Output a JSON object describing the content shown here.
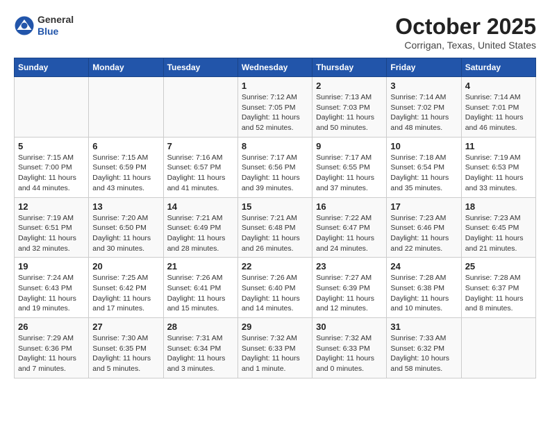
{
  "header": {
    "logo": {
      "general": "General",
      "blue": "Blue"
    },
    "title": "October 2025",
    "subtitle": "Corrigan, Texas, United States"
  },
  "weekdays": [
    "Sunday",
    "Monday",
    "Tuesday",
    "Wednesday",
    "Thursday",
    "Friday",
    "Saturday"
  ],
  "weeks": [
    [
      {
        "day": "",
        "info": ""
      },
      {
        "day": "",
        "info": ""
      },
      {
        "day": "",
        "info": ""
      },
      {
        "day": "1",
        "info": "Sunrise: 7:12 AM\nSunset: 7:05 PM\nDaylight: 11 hours and 52 minutes."
      },
      {
        "day": "2",
        "info": "Sunrise: 7:13 AM\nSunset: 7:03 PM\nDaylight: 11 hours and 50 minutes."
      },
      {
        "day": "3",
        "info": "Sunrise: 7:14 AM\nSunset: 7:02 PM\nDaylight: 11 hours and 48 minutes."
      },
      {
        "day": "4",
        "info": "Sunrise: 7:14 AM\nSunset: 7:01 PM\nDaylight: 11 hours and 46 minutes."
      }
    ],
    [
      {
        "day": "5",
        "info": "Sunrise: 7:15 AM\nSunset: 7:00 PM\nDaylight: 11 hours and 44 minutes."
      },
      {
        "day": "6",
        "info": "Sunrise: 7:15 AM\nSunset: 6:59 PM\nDaylight: 11 hours and 43 minutes."
      },
      {
        "day": "7",
        "info": "Sunrise: 7:16 AM\nSunset: 6:57 PM\nDaylight: 11 hours and 41 minutes."
      },
      {
        "day": "8",
        "info": "Sunrise: 7:17 AM\nSunset: 6:56 PM\nDaylight: 11 hours and 39 minutes."
      },
      {
        "day": "9",
        "info": "Sunrise: 7:17 AM\nSunset: 6:55 PM\nDaylight: 11 hours and 37 minutes."
      },
      {
        "day": "10",
        "info": "Sunrise: 7:18 AM\nSunset: 6:54 PM\nDaylight: 11 hours and 35 minutes."
      },
      {
        "day": "11",
        "info": "Sunrise: 7:19 AM\nSunset: 6:53 PM\nDaylight: 11 hours and 33 minutes."
      }
    ],
    [
      {
        "day": "12",
        "info": "Sunrise: 7:19 AM\nSunset: 6:51 PM\nDaylight: 11 hours and 32 minutes."
      },
      {
        "day": "13",
        "info": "Sunrise: 7:20 AM\nSunset: 6:50 PM\nDaylight: 11 hours and 30 minutes."
      },
      {
        "day": "14",
        "info": "Sunrise: 7:21 AM\nSunset: 6:49 PM\nDaylight: 11 hours and 28 minutes."
      },
      {
        "day": "15",
        "info": "Sunrise: 7:21 AM\nSunset: 6:48 PM\nDaylight: 11 hours and 26 minutes."
      },
      {
        "day": "16",
        "info": "Sunrise: 7:22 AM\nSunset: 6:47 PM\nDaylight: 11 hours and 24 minutes."
      },
      {
        "day": "17",
        "info": "Sunrise: 7:23 AM\nSunset: 6:46 PM\nDaylight: 11 hours and 22 minutes."
      },
      {
        "day": "18",
        "info": "Sunrise: 7:23 AM\nSunset: 6:45 PM\nDaylight: 11 hours and 21 minutes."
      }
    ],
    [
      {
        "day": "19",
        "info": "Sunrise: 7:24 AM\nSunset: 6:43 PM\nDaylight: 11 hours and 19 minutes."
      },
      {
        "day": "20",
        "info": "Sunrise: 7:25 AM\nSunset: 6:42 PM\nDaylight: 11 hours and 17 minutes."
      },
      {
        "day": "21",
        "info": "Sunrise: 7:26 AM\nSunset: 6:41 PM\nDaylight: 11 hours and 15 minutes."
      },
      {
        "day": "22",
        "info": "Sunrise: 7:26 AM\nSunset: 6:40 PM\nDaylight: 11 hours and 14 minutes."
      },
      {
        "day": "23",
        "info": "Sunrise: 7:27 AM\nSunset: 6:39 PM\nDaylight: 11 hours and 12 minutes."
      },
      {
        "day": "24",
        "info": "Sunrise: 7:28 AM\nSunset: 6:38 PM\nDaylight: 11 hours and 10 minutes."
      },
      {
        "day": "25",
        "info": "Sunrise: 7:28 AM\nSunset: 6:37 PM\nDaylight: 11 hours and 8 minutes."
      }
    ],
    [
      {
        "day": "26",
        "info": "Sunrise: 7:29 AM\nSunset: 6:36 PM\nDaylight: 11 hours and 7 minutes."
      },
      {
        "day": "27",
        "info": "Sunrise: 7:30 AM\nSunset: 6:35 PM\nDaylight: 11 hours and 5 minutes."
      },
      {
        "day": "28",
        "info": "Sunrise: 7:31 AM\nSunset: 6:34 PM\nDaylight: 11 hours and 3 minutes."
      },
      {
        "day": "29",
        "info": "Sunrise: 7:32 AM\nSunset: 6:33 PM\nDaylight: 11 hours and 1 minute."
      },
      {
        "day": "30",
        "info": "Sunrise: 7:32 AM\nSunset: 6:33 PM\nDaylight: 11 hours and 0 minutes."
      },
      {
        "day": "31",
        "info": "Sunrise: 7:33 AM\nSunset: 6:32 PM\nDaylight: 10 hours and 58 minutes."
      },
      {
        "day": "",
        "info": ""
      }
    ]
  ]
}
